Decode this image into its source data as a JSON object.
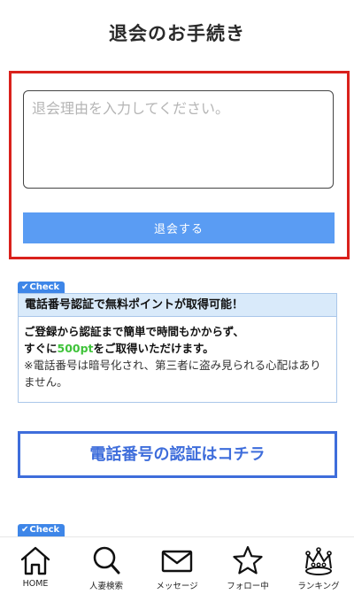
{
  "header": {
    "title": "退会のお手続き"
  },
  "withdraw": {
    "reason_placeholder": "退会理由を入力してください。",
    "button_label": "退会する"
  },
  "check_tag": {
    "icon": "check-icon",
    "label": "Check"
  },
  "info_card": {
    "heading": "電話番号認証で無料ポイントが取得可能！",
    "line1": "ご登録から認証まで簡単で時間もかからず、",
    "line2_prefix": "すぐに",
    "points": "500pt",
    "line2_suffix": "をご取得いただけます。",
    "note": "※電話番号は暗号化され、第三者に盗み見られる心配はありません。"
  },
  "verify_button": {
    "label": "電話番号の認証はコチラ"
  },
  "bottom_nav": {
    "items": [
      {
        "label": "HOME",
        "icon": "home-icon"
      },
      {
        "label": "人妻検索",
        "icon": "search-icon"
      },
      {
        "label": "メッセージ",
        "icon": "mail-icon"
      },
      {
        "label": "フォロー中",
        "icon": "star-icon"
      },
      {
        "label": "ランキング",
        "icon": "crown-icon"
      }
    ]
  },
  "colors": {
    "accent_blue": "#5a9cf3",
    "highlight_red": "#d9211c",
    "verify_blue": "#3e6ddb",
    "points_green": "#3fc33a"
  }
}
